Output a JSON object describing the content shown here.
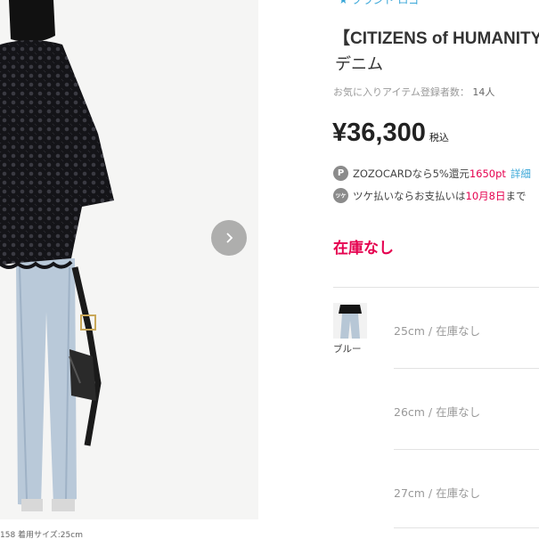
{
  "top_link": "★ ブランド ロゴ",
  "product": {
    "title": "【CITIZENS of HUMANITY】",
    "subtitle": "デニム",
    "favorites_label": "お気に入りアイテム登録者数：",
    "favorites_count": "14人",
    "price": "¥36,300",
    "tax_label": "税込"
  },
  "zozocard": {
    "icon": "P",
    "text_pre": "ZOZOCARDなら5%還元",
    "points": "1650pt",
    "detail_link": "詳細"
  },
  "tsuke": {
    "icon": "ツケ",
    "text_pre": "ツケ払いならお支払いは",
    "date": "10月8日",
    "text_post": "まで"
  },
  "stock_status": "在庫なし",
  "color": {
    "label": "ブルー"
  },
  "sizes": [
    {
      "label": "25cm / 在庫なし"
    },
    {
      "label": "26cm / 在庫なし"
    },
    {
      "label": "27cm / 在庫なし"
    }
  ],
  "photo_caption": "158 着用サイズ:25cm",
  "colors": {
    "accent_red": "#e5004f",
    "link_blue": "#3aa7d8",
    "badge_gray": "#8b8b8b"
  }
}
